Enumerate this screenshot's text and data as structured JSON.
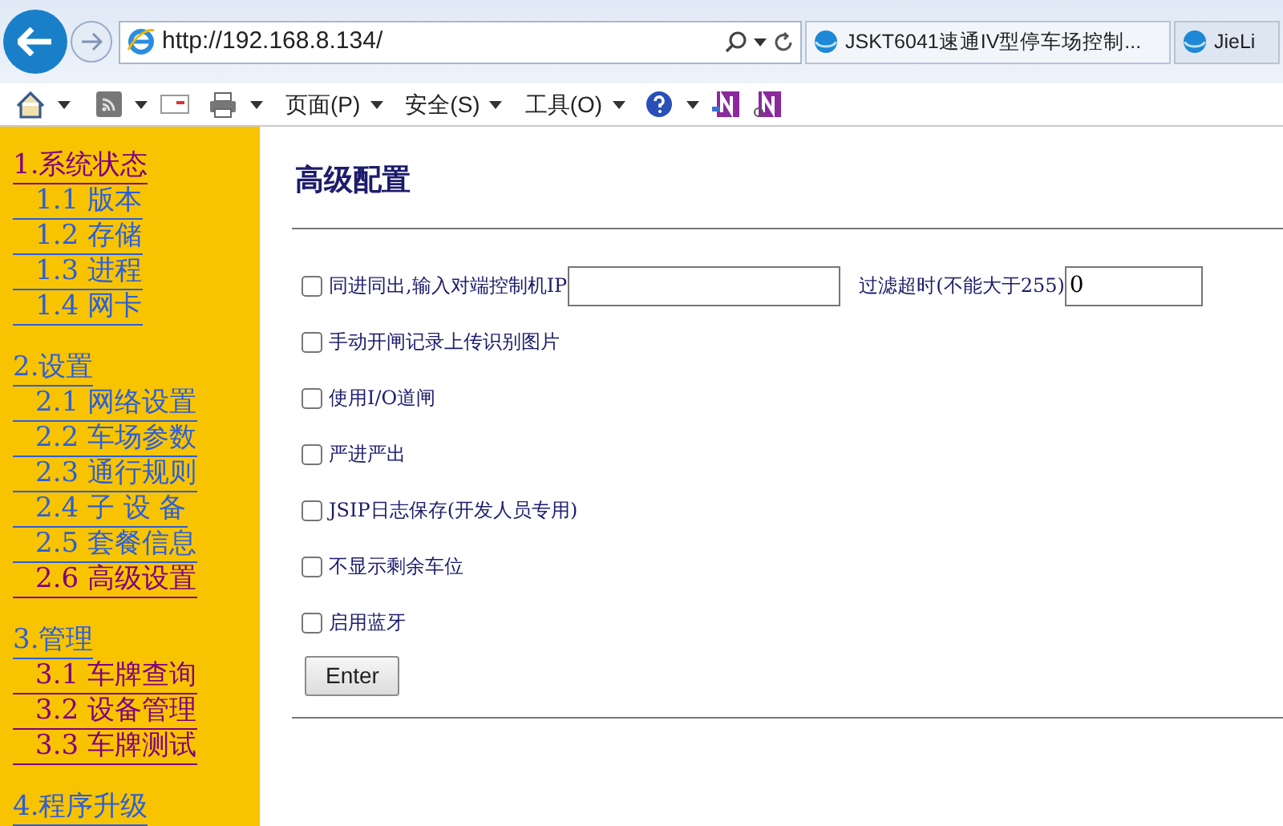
{
  "browser": {
    "address": "http://192.168.8.134/",
    "tabs": [
      {
        "label": "JSKT6041速通IV型停车场控制...",
        "selected": true
      },
      {
        "label": "JieLi",
        "selected": false
      }
    ],
    "menus": [
      "页面(P)",
      "安全(S)",
      "工具(O)"
    ]
  },
  "sidebar": {
    "groups": [
      {
        "title": {
          "label": "1.系统状态",
          "visited": true
        },
        "items": [
          {
            "label": "1.1 版本",
            "visited": false
          },
          {
            "label": "1.2 存储",
            "visited": false
          },
          {
            "label": "1.3 进程",
            "visited": false
          },
          {
            "label": "1.4 网卡",
            "visited": false
          }
        ]
      },
      {
        "title": {
          "label": "2.设置",
          "visited": false
        },
        "items": [
          {
            "label": "2.1 网络设置",
            "visited": false
          },
          {
            "label": "2.2 车场参数",
            "visited": false
          },
          {
            "label": "2.3 通行规则",
            "visited": false
          },
          {
            "label": "2.4 子 设 备",
            "visited": false
          },
          {
            "label": "2.5 套餐信息",
            "visited": false
          },
          {
            "label": "2.6 高级设置",
            "visited": true
          }
        ]
      },
      {
        "title": {
          "label": "3.管理",
          "visited": false
        },
        "items": [
          {
            "label": "3.1 车牌查询",
            "visited": true
          },
          {
            "label": "3.2 设备管理",
            "visited": true
          },
          {
            "label": "3.3 车牌测试",
            "visited": true
          }
        ]
      },
      {
        "title": {
          "label": "4.程序升级",
          "visited": false
        }
      }
    ]
  },
  "content": {
    "title": "高级配置",
    "options": [
      {
        "label": "同进同出,输入对端控制机IP",
        "checked": false,
        "fields": [
          {
            "kind": "wide"
          },
          {
            "kind": "narrow",
            "label": "过滤超时(不能大于255)",
            "value": "0"
          }
        ]
      },
      {
        "label": "手动开闸记录上传识别图片",
        "checked": false
      },
      {
        "label": "使用I/O道闸",
        "checked": false
      },
      {
        "label": "严进严出",
        "checked": false
      },
      {
        "label": "JSIP日志保存(开发人员专用)",
        "checked": false
      },
      {
        "label": "不显示剩余车位",
        "checked": false
      },
      {
        "label": "启用蓝牙",
        "checked": false
      }
    ],
    "button": "Enter"
  }
}
